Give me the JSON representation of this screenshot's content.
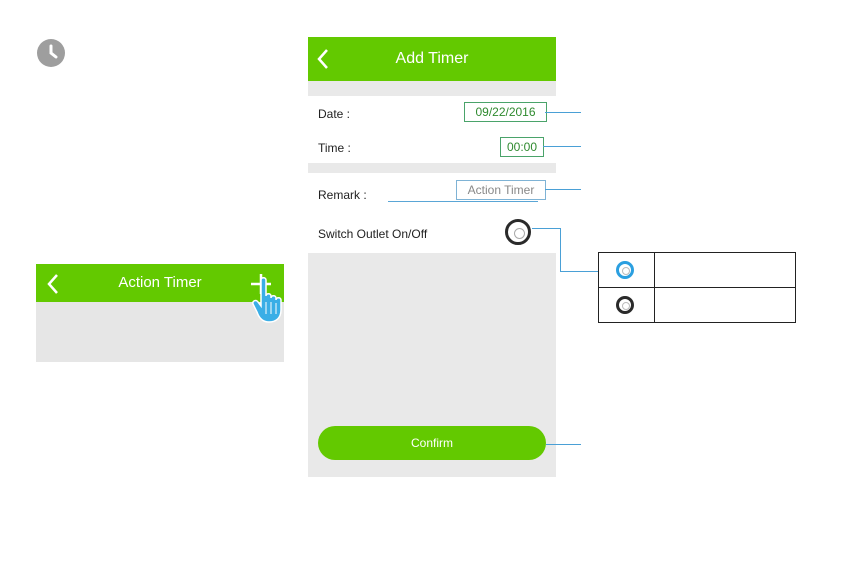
{
  "small_screen": {
    "title": "Action Timer",
    "back_icon": "chevron-left-icon",
    "add_icon": "plus-icon",
    "pointer_icon": "hand-pointer-icon"
  },
  "clock_icon": "clock-icon",
  "phone": {
    "title": "Add Timer",
    "back_icon": "chevron-left-icon",
    "date_label": "Date :",
    "date_value": "09/22/2016",
    "time_label": "Time :",
    "time_value": "00:00",
    "remark_label": "Remark :",
    "remark_placeholder": "Action Timer",
    "switch_label": "Switch Outlet On/Off",
    "confirm_label": "Confirm"
  },
  "legend": {
    "on_icon": "toggle-on-icon",
    "off_icon": "toggle-off-icon"
  },
  "colors": {
    "header_green": "#63c900",
    "value_green": "#2f8a2f",
    "callout_blue": "#4aa0d6",
    "toggle_on_blue": "#2b9fe0"
  }
}
